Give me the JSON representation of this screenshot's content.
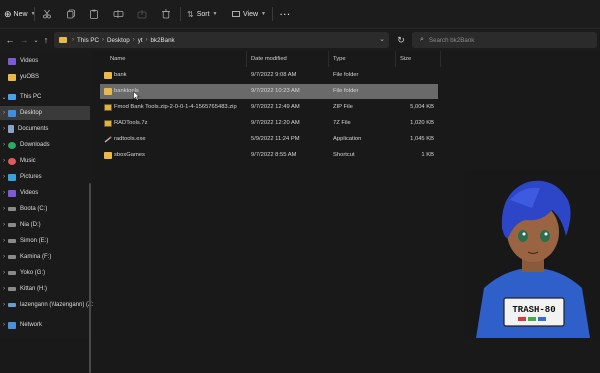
{
  "toolbar": {
    "new_label": "New",
    "sort_label": "Sort",
    "view_label": "View",
    "more_label": "···"
  },
  "address": {
    "crumbs": [
      "This PC",
      "Desktop",
      "yt",
      "bk2Bank"
    ]
  },
  "search": {
    "placeholder": "Search bk2Bank"
  },
  "sidebar": {
    "items": [
      {
        "label": "Videos",
        "icon": "videos-icon"
      },
      {
        "label": "yuOBS",
        "icon": "folder-icon"
      },
      {
        "label": "This PC",
        "icon": "pc-icon"
      },
      {
        "label": "Desktop",
        "icon": "desktop-icon"
      },
      {
        "label": "Documents",
        "icon": "documents-icon"
      },
      {
        "label": "Downloads",
        "icon": "downloads-icon"
      },
      {
        "label": "Music",
        "icon": "music-icon"
      },
      {
        "label": "Pictures",
        "icon": "pictures-icon"
      },
      {
        "label": "Videos",
        "icon": "videos-icon"
      },
      {
        "label": "Boota (C:)",
        "icon": "drive-icon"
      },
      {
        "label": "Nia (D:)",
        "icon": "drive-icon"
      },
      {
        "label": "Simon (E:)",
        "icon": "drive-icon"
      },
      {
        "label": "Kamina (F:)",
        "icon": "drive-icon"
      },
      {
        "label": "Yoko (G:)",
        "icon": "drive-icon"
      },
      {
        "label": "Kittan (H:)",
        "icon": "drive-icon"
      },
      {
        "label": "lazengann (\\\\lazengann) (Z:",
        "icon": "network-drive-icon"
      },
      {
        "label": "Network",
        "icon": "network-icon"
      }
    ]
  },
  "columns": {
    "name": "Name",
    "date": "Date modified",
    "type": "Type",
    "size": "Size"
  },
  "files": [
    {
      "name": "bank",
      "date": "9/7/2022 9:08 AM",
      "type": "File folder",
      "size": "",
      "icon": "folder-icon"
    },
    {
      "name": "banktools",
      "date": "9/7/2022 10:23 AM",
      "type": "File folder",
      "size": "",
      "icon": "folder-icon"
    },
    {
      "name": "Fmod Bank Tools.zip-2-0-0-1-4-1565765483.zip",
      "date": "9/7/2022 12:49 AM",
      "type": "ZIP File",
      "size": "5,004 KB",
      "icon": "zip-icon"
    },
    {
      "name": "RADTools.7z",
      "date": "9/7/2022 12:20 AM",
      "type": "7Z File",
      "size": "1,020 KB",
      "icon": "7z-icon"
    },
    {
      "name": "radtools.exe",
      "date": "5/9/2022 11:24 PM",
      "type": "Application",
      "size": "1,045 KB",
      "icon": "exe-icon"
    },
    {
      "name": "sboxGames",
      "date": "9/7/2022 8:55 AM",
      "type": "Shortcut",
      "size": "1 KB",
      "icon": "shortcut-icon"
    }
  ],
  "avatar": {
    "shirt_text": "TRASH-80"
  },
  "colors": {
    "folder": "#e8b84a",
    "selected_row": "#6a6a6a",
    "selected_sidebar": "#3a3a3a",
    "shirt": "#2f5fc9",
    "hair": "#2d46c8"
  }
}
